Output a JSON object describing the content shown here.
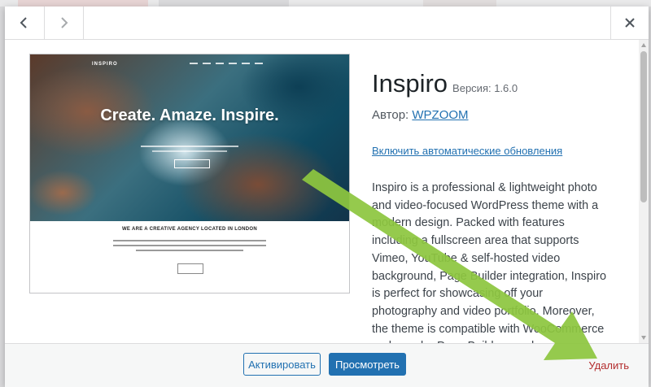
{
  "theme": {
    "name": "Inspiro",
    "version_label": "Версия: 1.6.0",
    "author_label": "Автор:",
    "author_name": "WPZOOM",
    "auto_updates_link": "Включить автоматические обновления",
    "description": "Inspiro is a professional & lightweight photo and video-focused WordPress theme with a modern design. Packed with features including a fullscreen area that supports Vimeo, YouTube & self-hosted video background, Page Builder integration, Inspiro is perfect for showcasing off your photography and video portfolio. Moreover, the theme is compatible with WooCommerce and popular Page Builders such as Elementor,"
  },
  "screenshot": {
    "logo": "INSPIRO",
    "headline": "Create. Amaze. Inspire.",
    "tagline": "WE ARE A CREATIVE AGENCY LOCATED IN LONDON"
  },
  "footer": {
    "activate_label": "Активировать",
    "preview_label": "Просмотреть",
    "delete_label": "Удалить"
  },
  "colors": {
    "accent": "#2271b1",
    "delete": "#b32d2e",
    "arrow": "#8dc63f"
  },
  "icons": {
    "prev": "chevron-left-icon",
    "next": "chevron-right-icon",
    "close": "close-icon"
  }
}
